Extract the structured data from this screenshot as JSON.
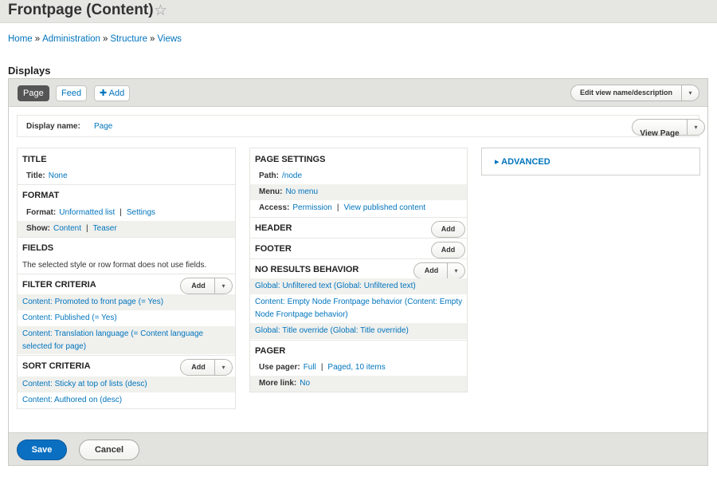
{
  "page": {
    "title": "Frontpage (Content)",
    "star_icon": "☆",
    "breadcrumb": [
      "Home",
      "Administration",
      "Structure",
      "Views"
    ],
    "breadcrumb_sep": "»"
  },
  "displays": {
    "heading": "Displays",
    "tabs": [
      {
        "label": "Page",
        "active": true
      },
      {
        "label": "Feed",
        "active": false
      }
    ],
    "add_label": "✚ Add",
    "edit_view_label": "Edit view name/description",
    "caret": "▾"
  },
  "display_name": {
    "label": "Display name:",
    "value": "Page",
    "view_page_label": "View Page"
  },
  "left": {
    "title_section": {
      "heading": "TITLE",
      "key": "Title:",
      "value": "None"
    },
    "format_section": {
      "heading": "FORMAT",
      "format_key": "Format:",
      "format_value": "Unformatted list",
      "format_settings": "Settings",
      "show_key": "Show:",
      "show_value": "Content",
      "show_extra": "Teaser"
    },
    "fields_section": {
      "heading": "FIELDS",
      "note": "The selected style or row format does not use fields."
    },
    "filter_section": {
      "heading": "FILTER CRITERIA",
      "add_label": "Add",
      "items": [
        "Content: Promoted to front page (= Yes)",
        "Content: Published (= Yes)",
        "Content: Translation language (= Content language selected for page)"
      ]
    },
    "sort_section": {
      "heading": "SORT CRITERIA",
      "add_label": "Add",
      "items": [
        "Content: Sticky at top of lists (desc)",
        "Content: Authored on (desc)"
      ]
    }
  },
  "middle": {
    "page_settings": {
      "heading": "PAGE SETTINGS",
      "path_key": "Path:",
      "path_value": "/node",
      "menu_key": "Menu:",
      "menu_value": "No menu",
      "access_key": "Access:",
      "access_value": "Permission",
      "access_extra": "View published content"
    },
    "header": {
      "heading": "HEADER",
      "add_label": "Add"
    },
    "footer": {
      "heading": "FOOTER",
      "add_label": "Add"
    },
    "no_results": {
      "heading": "NO RESULTS BEHAVIOR",
      "add_label": "Add",
      "items": [
        "Global: Unfiltered text (Global: Unfiltered text)",
        "Content: Empty Node Frontpage behavior (Content: Empty Node Frontpage behavior)",
        "Global: Title override (Global: Title override)"
      ]
    },
    "pager": {
      "heading": "PAGER",
      "use_key": "Use pager:",
      "use_value": "Full",
      "use_extra": "Paged, 10 items",
      "more_key": "More link:",
      "more_value": "No"
    }
  },
  "advanced": {
    "label": "▸ ADVANCED"
  },
  "footer": {
    "save": "Save",
    "cancel": "Cancel"
  },
  "pipe": "|",
  "colors": {
    "link": "#0074bd",
    "primary_button": "#0a6fc1",
    "active_tab": "#555555"
  }
}
